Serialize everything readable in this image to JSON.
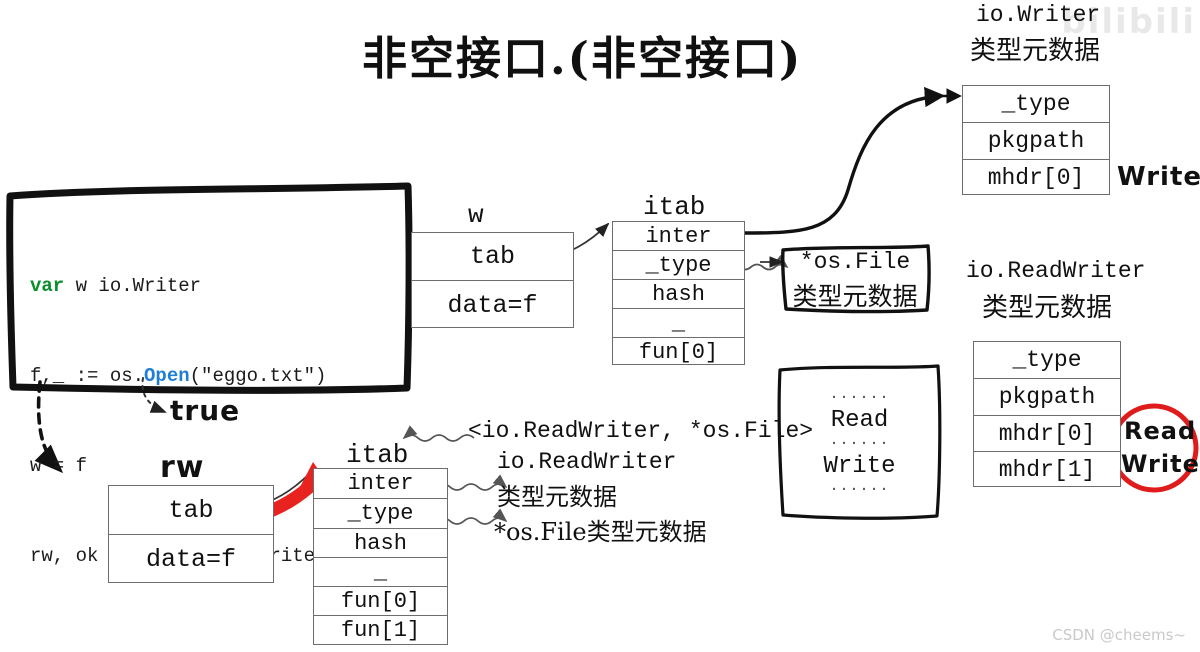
{
  "title": "非空接口.(非空接口)",
  "watermarks": {
    "bilibili": "bilibili",
    "csdn": "CSDN @cheems~"
  },
  "code_box": {
    "lines": [
      {
        "parts": [
          {
            "t": "var",
            "c": "kw-var"
          },
          {
            "t": " w io.Writer",
            "c": ""
          }
        ]
      },
      {
        "parts": [
          {
            "t": "f,_ := os.",
            "c": ""
          },
          {
            "t": "Open",
            "c": "kw-open"
          },
          {
            "t": "(\"eggo.txt\")",
            "c": ""
          }
        ]
      },
      {
        "parts": [
          {
            "t": "w = f",
            "c": ""
          }
        ]
      },
      {
        "parts": [
          {
            "t": "rw, ok := w.(io.ReadWriter)",
            "c": ""
          }
        ]
      }
    ],
    "plain_text": "var w io.Writer\nf,_ := os.Open(\"eggo.txt\")\nw = f\nrw, ok := w.(io.ReadWriter)"
  },
  "annotations": {
    "true_label": "true",
    "generic_pair": "<io.ReadWriter, *os.File>",
    "readwriter_meta_line1": "io.ReadWriter",
    "readwriter_meta_line2": "类型元数据",
    "osfile_meta_line": "*os.File类型元数据"
  },
  "w_iface": {
    "name": "w",
    "rows": [
      "tab",
      "data=f"
    ]
  },
  "rw_iface": {
    "name": "rw",
    "rows": [
      "tab",
      "data=f"
    ]
  },
  "itab_top": {
    "name": "itab",
    "rows": [
      "inter",
      "_type",
      "hash",
      "_",
      "fun[0]"
    ]
  },
  "itab_bottom": {
    "name": "itab",
    "rows": [
      "inter",
      "_type",
      "hash",
      "_",
      "fun[0]",
      "fun[1]"
    ]
  },
  "io_writer_meta": {
    "title_line1": "io.Writer",
    "title_line2": "类型元数据",
    "rows": [
      "_type",
      "pkgpath",
      "mhdr[0]"
    ],
    "method_label": "Write"
  },
  "io_readwriter_meta": {
    "title_line1": "io.ReadWriter",
    "title_line2": "类型元数据",
    "rows": [
      "_type",
      "pkgpath",
      "mhdr[0]",
      "mhdr[1]"
    ],
    "circled_methods": [
      "Read",
      "Write"
    ],
    "circle_color": "#e01b1b"
  },
  "osfile_meta_box": {
    "line1": "*os.File",
    "line2": "类型元数据"
  },
  "methods_box": {
    "lines": [
      "······",
      "Read",
      "······",
      "Write",
      "······"
    ]
  },
  "colors": {
    "ink": "#111111",
    "box_stroke": "#6d6d6d",
    "keyword_green": "#0a8f2a",
    "keyword_blue": "#1f7fd6",
    "highlight_red": "#e8231f",
    "watermark_grey": "#c9c9c9"
  }
}
